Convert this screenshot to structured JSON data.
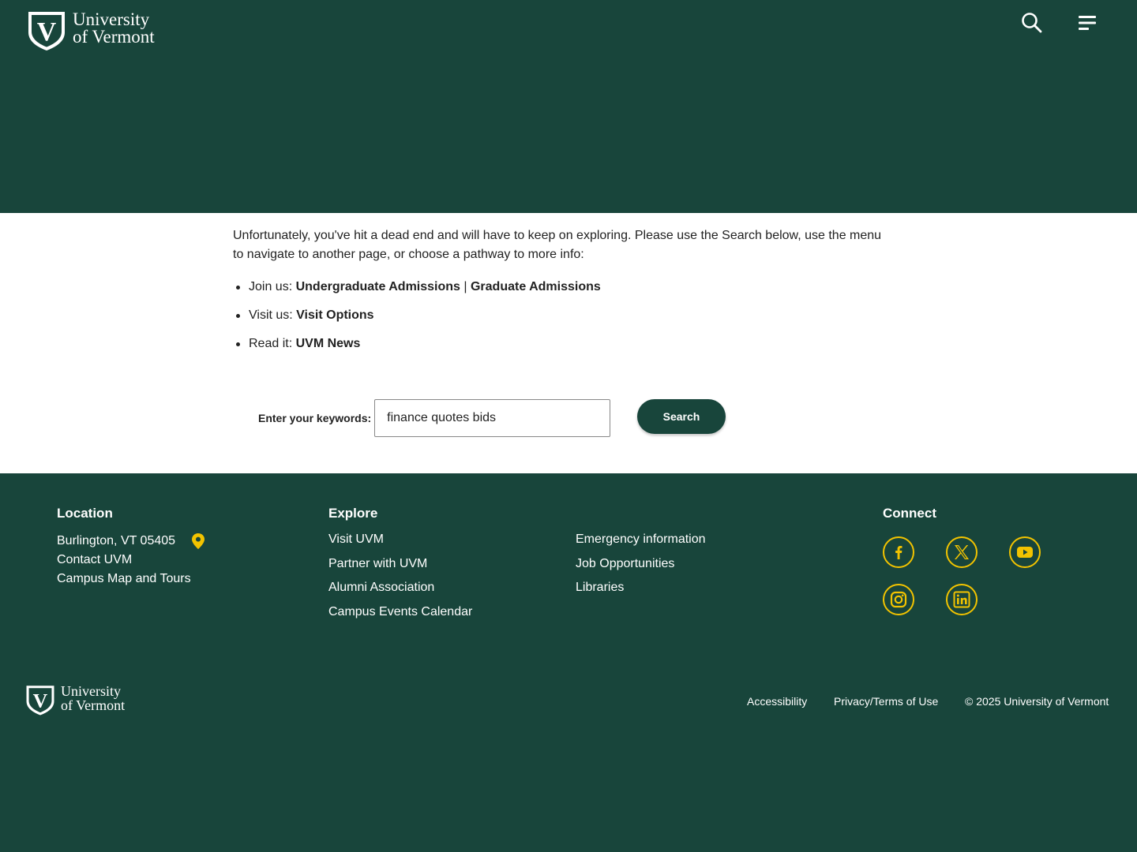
{
  "brand": {
    "name_line1": "University",
    "name_line2": "of Vermont",
    "shield_letter": "V"
  },
  "header": {
    "search_icon": "search-icon",
    "menu_icon": "hamburger-menu-icon"
  },
  "main": {
    "intro": "Unfortunately, you've hit a dead end and will have to keep on exploring. Please use the Search below, use the menu to navigate to another page, or choose a pathway to more info:",
    "pathways": [
      {
        "prefix": "Join us: ",
        "links": [
          "Undergraduate Admissions",
          "Graduate Admissions"
        ],
        "separator": " | "
      },
      {
        "prefix": "Visit us: ",
        "links": [
          "Visit Options"
        ]
      },
      {
        "prefix": "Read it: ",
        "links": [
          "UVM News"
        ]
      }
    ],
    "search": {
      "label": "Enter your keywords:",
      "value": "finance quotes bids",
      "button": "Search"
    }
  },
  "footer": {
    "location": {
      "title": "Location",
      "address": "Burlington, VT 05405",
      "links": [
        "Contact UVM",
        "Campus Map and Tours"
      ]
    },
    "explore": {
      "title": "Explore",
      "col1": [
        "Visit UVM",
        "Partner with UVM",
        "Alumni Association",
        "Campus Events Calendar"
      ],
      "col2": [
        "Emergency information",
        "Job Opportunities",
        "Libraries"
      ]
    },
    "connect": {
      "title": "Connect",
      "icons": [
        "facebook-icon",
        "x-icon",
        "youtube-icon",
        "instagram-icon",
        "linkedin-icon"
      ]
    },
    "legal": {
      "accessibility": "Accessibility",
      "privacy": "Privacy/Terms of Use",
      "copyright": "© 2025 University of Vermont"
    }
  },
  "colors": {
    "brand_green": "#18453b",
    "accent_gold": "#f2c300",
    "white": "#ffffff"
  }
}
